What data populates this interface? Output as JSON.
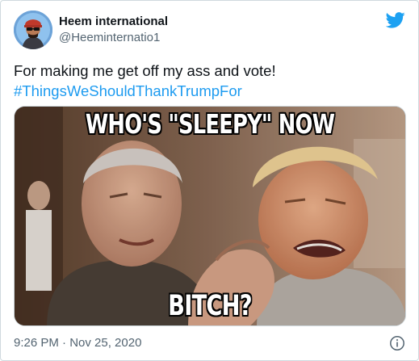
{
  "tweet": {
    "author": {
      "display_name": "Heem international",
      "handle": "@Heeminternatio1",
      "avatar_icon": "cartoon-avatar-icon"
    },
    "platform_icon": "twitter-bird-icon",
    "text": "For making me get off my ass and vote!",
    "hashtag": "#ThingsWeShouldThankTrumpFor",
    "media": {
      "top_caption": "WHO'S \"SLEEPY\" NOW",
      "bottom_caption": "BITCH?"
    },
    "timestamp": "9:26 PM · Nov 25, 2020",
    "info_icon": "info-icon"
  },
  "colors": {
    "link": "#1d9bf0",
    "twitter_brand": "#1da1f2",
    "secondary_text": "#536471",
    "border": "#cfd9de"
  }
}
